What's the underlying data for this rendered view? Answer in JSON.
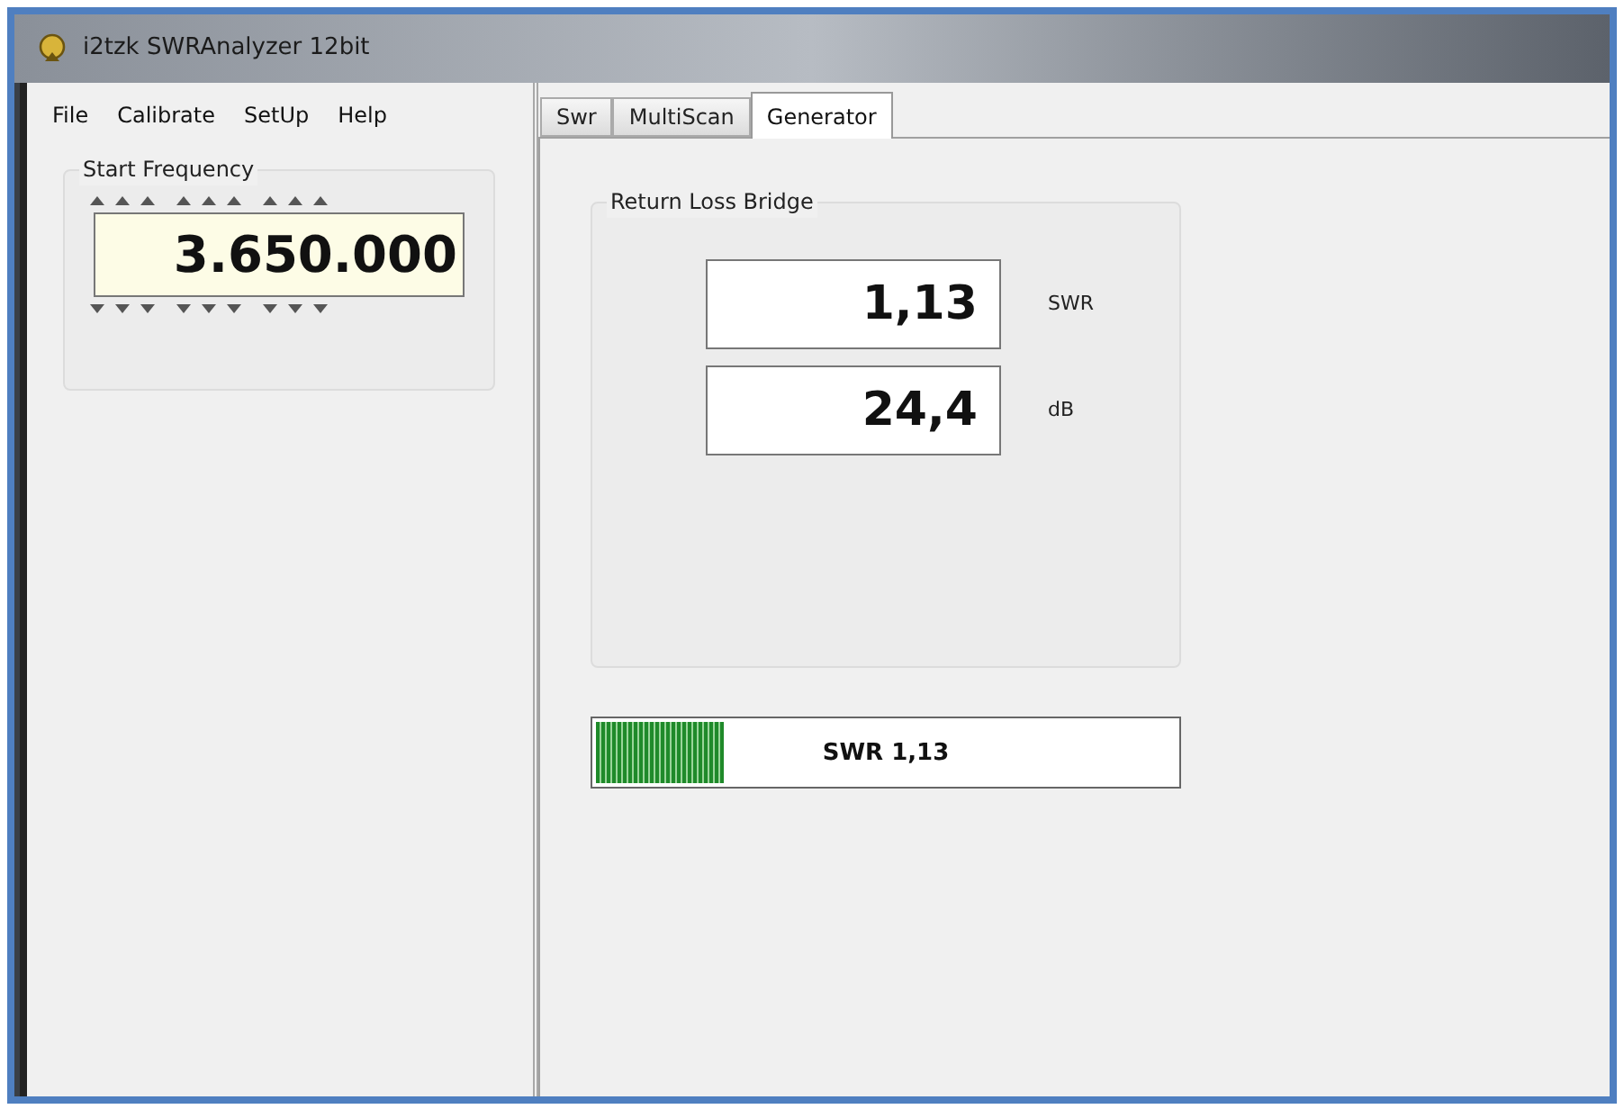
{
  "window": {
    "title": "i2tzk SWRAnalyzer 12bit"
  },
  "menu": [
    "File",
    "Calibrate",
    "SetUp",
    "Help"
  ],
  "start_frequency": {
    "label": "Start Frequency",
    "value": "3.650.000"
  },
  "tabs": [
    {
      "label": "Swr",
      "selected": false
    },
    {
      "label": "MultiScan",
      "selected": false
    },
    {
      "label": "Generator",
      "selected": true
    }
  ],
  "return_loss_bridge": {
    "title": "Return Loss Bridge",
    "readings": [
      {
        "value": "1,13",
        "unit": "SWR"
      },
      {
        "value": "24,4",
        "unit": "dB"
      }
    ]
  },
  "swr_bar": {
    "level": 0.22,
    "label": "SWR 1,13"
  }
}
